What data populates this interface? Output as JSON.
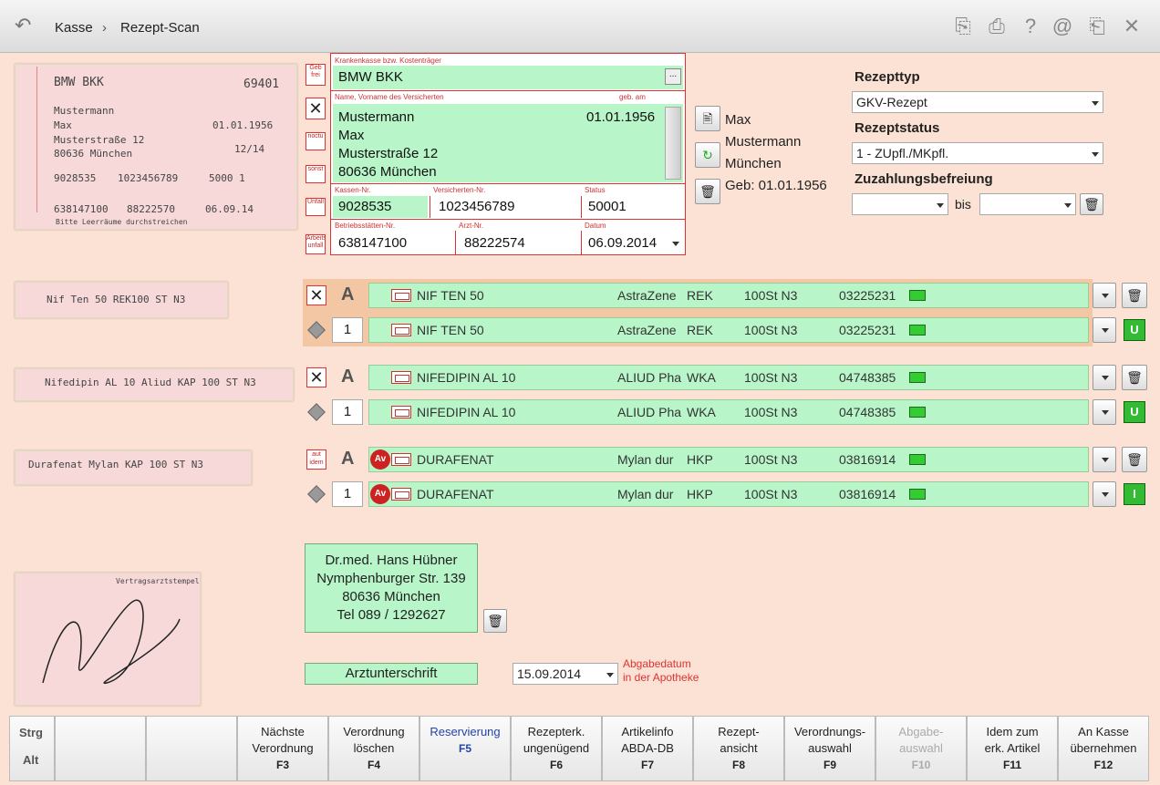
{
  "topbar": {
    "back": "back-arrow",
    "crumb1": "Kasse",
    "crumb2": "Rezept-Scan"
  },
  "form": {
    "kasse_label": "Krankenkasse bzw. Kostenträger",
    "kasse": "BMW BKK",
    "kasse_btn": "...",
    "name_label": "Name, Vorname des Versicherten",
    "geb_label": "geb. am",
    "name1": "Mustermann",
    "name2": "Max",
    "street": "Musterstraße 12",
    "city": "80636 München",
    "geb": "01.01.1956",
    "knr_label": "Kassen-Nr.",
    "knr": "9028535",
    "vnr_label": "Versicherten-Nr.",
    "vnr": "1023456789",
    "status_label": "Status",
    "status": "50001",
    "bsnr_label": "Betriebsstätten-Nr.",
    "bsnr": "638147100",
    "arzt_label": "Arzt-Nr.",
    "arzt": "88222574",
    "datum_label": "Datum",
    "datum": "06.09.2014",
    "left_labels": [
      "Geb frei",
      "noctu",
      "sonst",
      "Unfall",
      "Arbeits unfall"
    ]
  },
  "patient": {
    "l1": "Max",
    "l2": "Mustermann",
    "l3": "München",
    "l4": "Geb: 01.01.1956"
  },
  "rezept": {
    "typ_label": "Rezepttyp",
    "typ": "GKV-Rezept",
    "status_label": "Rezeptstatus",
    "status": "1 - ZUpfl./MKpfl.",
    "befreiung_label": "Zuzahlungsbefreiung",
    "bis": "bis"
  },
  "scan": {
    "kasse": "BMW BKK",
    "num": "69401",
    "n1": "Mustermann",
    "n2": "Max",
    "geb": "01.01.1956",
    "street": "Musterstraße 12",
    "city": "80636 München",
    "nr": "12/14",
    "k": "9028535",
    "v": "1023456789",
    "s": "5000 1",
    "b": "638147100",
    "a": "88222570",
    "d": "06.09.14",
    "foot": "Bitte Leerräume durchstreichen",
    "line1": "Nif Ten 50 REK100 ST N3",
    "line2": "Nifedipin AL 10 Aliud KAP 100 ST N3",
    "line3": "Durafenat Mylan KAP 100 ST N3",
    "stamp": "Vertragsarztstempel"
  },
  "items": [
    {
      "mark": "A",
      "name": "NIF TEN 50",
      "hersteller": "AstraZene",
      "kz": "REK",
      "menge": "100St N3",
      "pzn": "03225231"
    },
    {
      "qty": "1",
      "name": "NIF TEN 50",
      "hersteller": "AstraZene",
      "kz": "REK",
      "menge": "100St N3",
      "pzn": "03225231",
      "btn": "U"
    },
    {
      "mark": "A",
      "name": "NIFEDIPIN AL 10",
      "hersteller": "ALIUD Pha",
      "kz": "WKA",
      "menge": "100St N3",
      "pzn": "04748385"
    },
    {
      "qty": "1",
      "name": "NIFEDIPIN AL 10",
      "hersteller": "ALIUD Pha",
      "kz": "WKA",
      "menge": "100St N3",
      "pzn": "04748385",
      "btn": "U"
    },
    {
      "mark": "A",
      "name": "DURAFENAT",
      "hersteller": "Mylan dur",
      "kz": "HKP",
      "menge": "100St N3",
      "pzn": "03816914",
      "av": "Av"
    },
    {
      "qty": "1",
      "name": "DURAFENAT",
      "hersteller": "Mylan dur",
      "kz": "HKP",
      "menge": "100St N3",
      "pzn": "03816914",
      "btn": "I",
      "av": "Av"
    }
  ],
  "arzt": {
    "l1": "Dr.med. Hans Hübner",
    "l2": "Nymphenburger Str. 139",
    "l3": "80636 München",
    "l4": "Tel 089 / 1292627",
    "btn": "Arztunterschrift",
    "date": "15.09.2014",
    "note1": "Abgabedatum",
    "note2": "in der Apotheke"
  },
  "fkeys": {
    "strg": "Strg",
    "alt": "Alt",
    "keys": [
      {
        "l1": "Nächste",
        "l2": "Verordnung",
        "k": "F3"
      },
      {
        "l1": "Verordnung",
        "l2": "löschen",
        "k": "F4"
      },
      {
        "l1": "Reservierung",
        "l2": "",
        "k": "F5"
      },
      {
        "l1": "Rezepterk.",
        "l2": "ungenügend",
        "k": "F6"
      },
      {
        "l1": "Artikelinfo",
        "l2": "ABDA-DB",
        "k": "F7"
      },
      {
        "l1": "Rezept-",
        "l2": "ansicht",
        "k": "F8"
      },
      {
        "l1": "Verordnungs-",
        "l2": "auswahl",
        "k": "F9"
      },
      {
        "l1": "Abgabe-",
        "l2": "auswahl",
        "k": "F10"
      },
      {
        "l1": "Idem zum",
        "l2": "erk. Artikel",
        "k": "F11"
      },
      {
        "l1": "An Kasse",
        "l2": "übernehmen",
        "k": "F12"
      }
    ]
  },
  "colors": {
    "bg": "#fbe2d4",
    "green": "#b8f5c8",
    "red": "#d33"
  }
}
